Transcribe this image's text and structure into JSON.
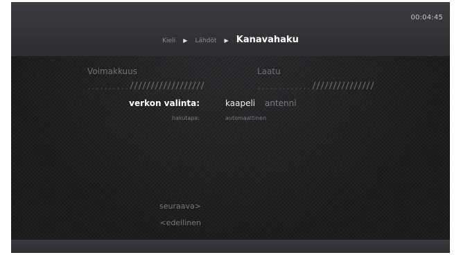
{
  "header": {
    "clock": "00:04:45",
    "breadcrumb": {
      "steps": [
        "Kieli",
        "Lähdöt"
      ],
      "separator": "▶",
      "current": "Kanavahaku"
    }
  },
  "meters": {
    "strength": {
      "label": "Voimakkuus",
      "level": 0.65
    },
    "quality": {
      "label": "Laatu",
      "level": 0.55
    }
  },
  "settings": {
    "network": {
      "label": "verkon valinta:",
      "options": [
        "kaapeli",
        "antenni"
      ],
      "selected": "kaapeli"
    },
    "search_mode": {
      "label": "hakutapa:",
      "value": "automaattinen"
    }
  },
  "nav": {
    "next": "seuraava>",
    "previous": "<edellinen"
  },
  "colors": {
    "background": "#1c1c1e",
    "bar": "#36373b",
    "text_active": "#ffffff",
    "text_dim": "#77787c"
  }
}
